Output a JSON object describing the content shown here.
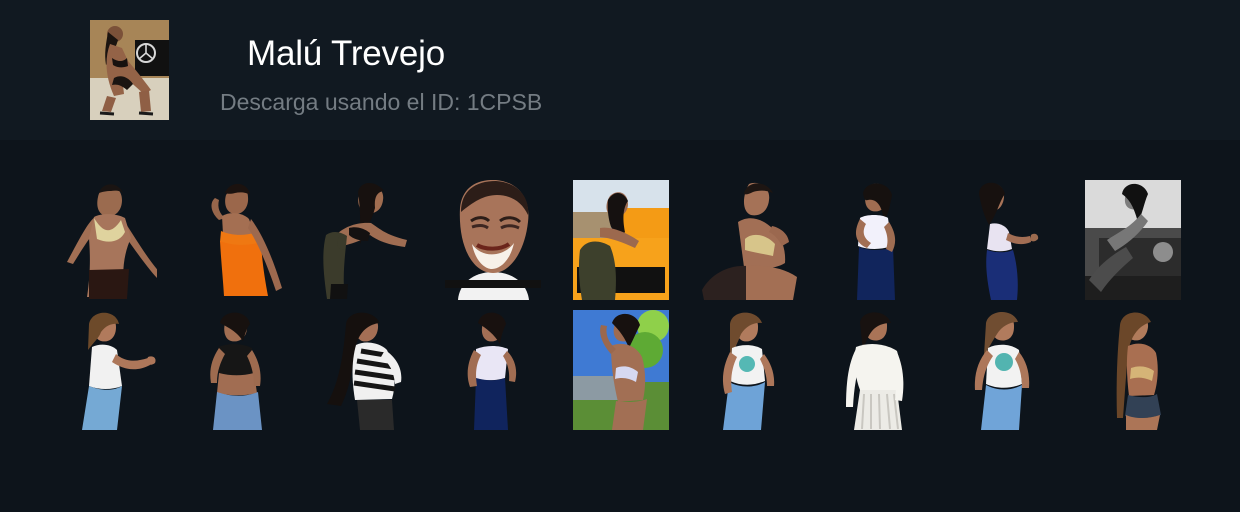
{
  "header": {
    "title": "Malú Trevejo",
    "subtitle": "Descarga usando el ID: 1CPSB",
    "cover_icon": "pack-cover-photo-icon"
  },
  "colors": {
    "page_background": "#0d141b",
    "header_background": "#111921",
    "title_text": "#ffffff",
    "subtitle_text": "#747c83"
  },
  "stickers": [
    {
      "icon": "sticker-pose-1-icon"
    },
    {
      "icon": "sticker-pose-2-icon"
    },
    {
      "icon": "sticker-pose-3-icon"
    },
    {
      "icon": "sticker-smile-face-icon"
    },
    {
      "icon": "sticker-photo-orange-car-icon"
    },
    {
      "icon": "sticker-pose-5-icon"
    },
    {
      "icon": "sticker-pose-6-icon"
    },
    {
      "icon": "sticker-pose-7-icon"
    },
    {
      "icon": "sticker-photo-grayscale-car-icon"
    },
    {
      "icon": "sticker-pose-10-icon"
    },
    {
      "icon": "sticker-pose-11-icon"
    },
    {
      "icon": "sticker-pose-12-icon"
    },
    {
      "icon": "sticker-pose-13-icon"
    },
    {
      "icon": "sticker-photo-garden-icon"
    },
    {
      "icon": "sticker-pose-15-icon"
    },
    {
      "icon": "sticker-pose-16-icon"
    },
    {
      "icon": "sticker-pose-17-icon"
    },
    {
      "icon": "sticker-pose-18-icon"
    }
  ]
}
